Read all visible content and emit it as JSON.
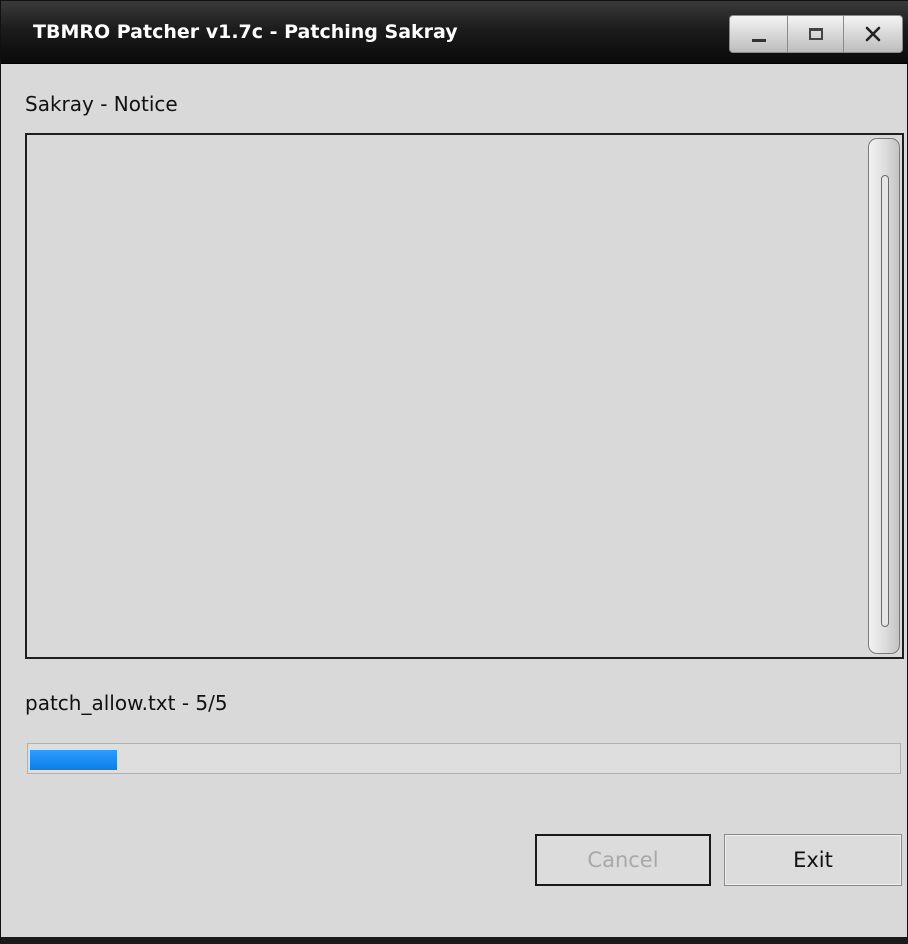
{
  "window": {
    "title": "TBMRO Patcher v1.7c - Patching Sakray"
  },
  "title_controls": {
    "minimize_icon": "minimize-icon",
    "maximize_icon": "maximize-icon",
    "close_icon": "close-icon"
  },
  "notice": {
    "label": "Sakray - Notice",
    "content": ""
  },
  "status": {
    "file_label": "patch_allow.txt - 5/5"
  },
  "progress": {
    "fraction": 0.1,
    "color": "#0a7fe8"
  },
  "buttons": {
    "cancel_label": "Cancel",
    "cancel_enabled": false,
    "exit_label": "Exit"
  }
}
